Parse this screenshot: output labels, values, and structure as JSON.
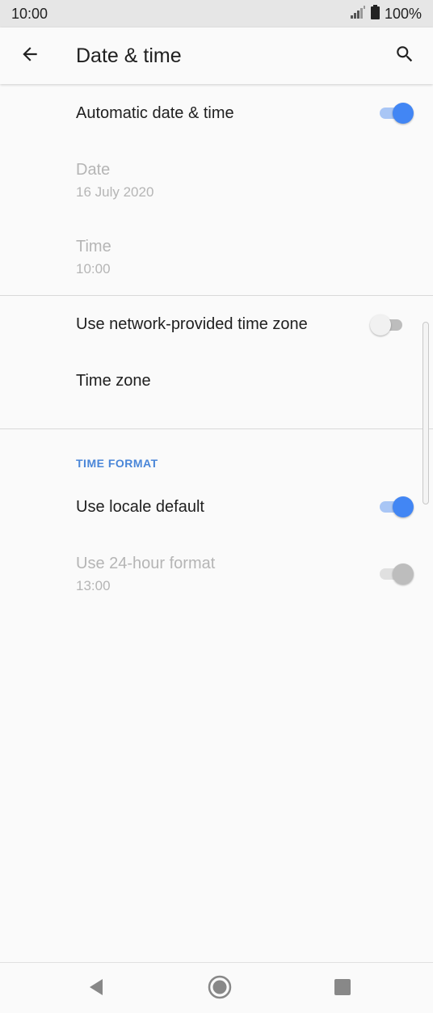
{
  "status_bar": {
    "time": "10:00",
    "battery": "100%"
  },
  "header": {
    "title": "Date & time"
  },
  "settings": {
    "automatic_date_time": {
      "label": "Automatic date & time",
      "enabled": true
    },
    "date": {
      "label": "Date",
      "value": "16 July 2020"
    },
    "time": {
      "label": "Time",
      "value": "10:00"
    },
    "network_time_zone": {
      "label": "Use network-provided time zone",
      "enabled": false
    },
    "time_zone": {
      "label": "Time zone"
    },
    "time_format_section": "TIME FORMAT",
    "use_locale_default": {
      "label": "Use locale default",
      "enabled": true
    },
    "use_24_hour": {
      "label": "Use 24-hour format",
      "value": "13:00",
      "enabled": true
    }
  },
  "colors": {
    "accent": "#4286f4",
    "section_header": "#4a86d8",
    "disabled_text": "#b5b5b5"
  },
  "icons": {
    "back": "arrow-back-icon",
    "search": "search-icon",
    "nav_back": "triangle-back-icon",
    "nav_home": "circle-home-icon",
    "nav_recents": "square-recents-icon"
  }
}
